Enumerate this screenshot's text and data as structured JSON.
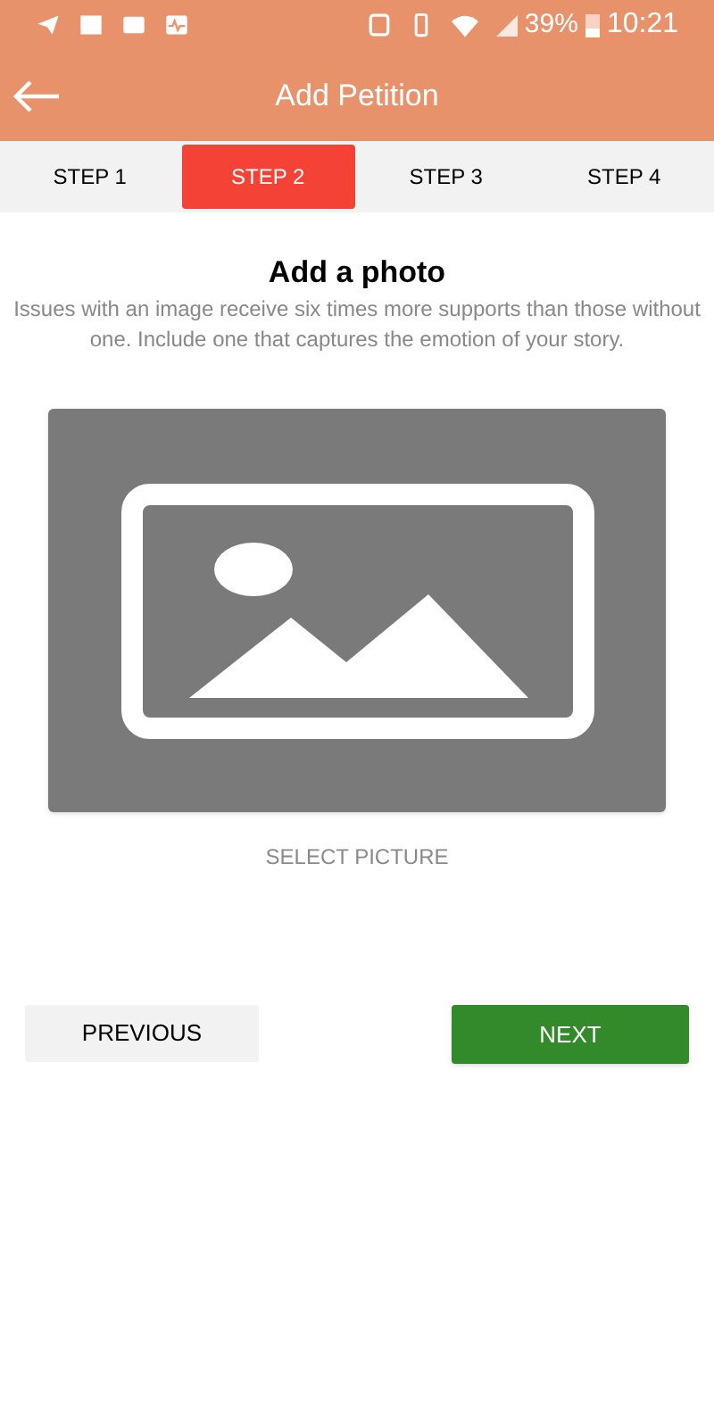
{
  "status_bar": {
    "battery": "39%",
    "time": "10:21"
  },
  "header": {
    "title": "Add Petition"
  },
  "steps": [
    {
      "label": "STEP 1",
      "selected": false
    },
    {
      "label": "STEP 2",
      "selected": true
    },
    {
      "label": "STEP 3",
      "selected": false
    },
    {
      "label": "STEP 4",
      "selected": false
    }
  ],
  "heading": "Add a photo",
  "description": "Issues with an image receive six times more supports than those without one. Include one that captures the emotion of your story.",
  "select_label": "SELECT PICTURE",
  "buttons": [
    {
      "label": "PREVIOUS",
      "kind": "secondary"
    },
    {
      "label": "NEXT",
      "kind": "primary"
    }
  ]
}
